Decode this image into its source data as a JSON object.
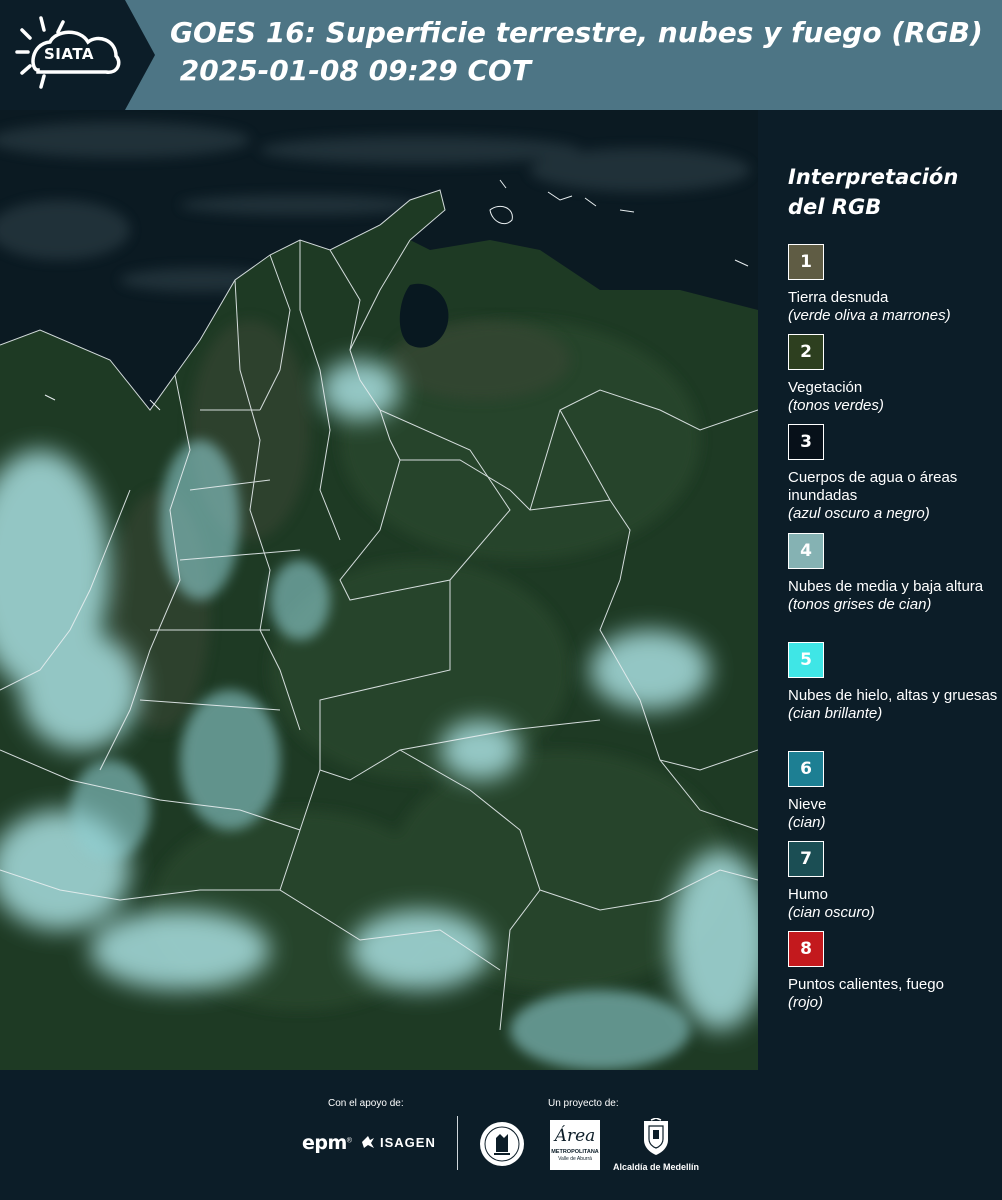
{
  "header": {
    "logo_text": "SIATA",
    "title_line1": "GOES 16: Superficie terrestre, nubes y fuego (RGB)",
    "title_line2": " 2025-01-08 09:29 COT"
  },
  "legend": {
    "title_line1": "Interpretación",
    "title_line2": "del RGB",
    "items": [
      {
        "number": "1",
        "color": "#5f5c44",
        "label": "Tierra desnuda",
        "sub": "(verde oliva a marrones)"
      },
      {
        "number": "2",
        "color": "#2d3f1f",
        "label": "Vegetación",
        "sub": "(tonos verdes)"
      },
      {
        "number": "3",
        "color": "#071019",
        "label": "Cuerpos de agua o áreas inundadas",
        "sub": "(azul oscuro a negro)"
      },
      {
        "number": "4",
        "color": "#85b2b3",
        "label": "Nubes de media y baja altura",
        "sub": "(tonos grises de cian)"
      },
      {
        "number": "5",
        "color": "#3fe6e6",
        "label": "Nubes de hielo, altas y gruesas",
        "sub": "(cian brillante)"
      },
      {
        "number": "6",
        "color": "#1d7f93",
        "label": "Nieve",
        "sub": "(cian)"
      },
      {
        "number": "7",
        "color": "#1b4e54",
        "label": "Humo",
        "sub": "(cian oscuro)"
      },
      {
        "number": "8",
        "color": "#c3191d",
        "label": "Puntos calientes, fuego",
        "sub": "(rojo)"
      }
    ]
  },
  "footer": {
    "support_label": "Con el apoyo de:",
    "project_label": "Un proyecto de:",
    "epm": "epm",
    "isagen": "ISAGEN",
    "area_script": "Área",
    "area_name": "METROPOLITANA",
    "area_sub": "Valle de Aburrá",
    "alcaldia": "Alcaldía de Medellín"
  },
  "colors": {
    "header_bg": "#4d7585",
    "logo_bg": "#0c1d28",
    "panel_bg": "#0c1d28",
    "ocean": "#0b1a22",
    "land": "#1e3a24",
    "cloud": "#a8dfe0"
  }
}
